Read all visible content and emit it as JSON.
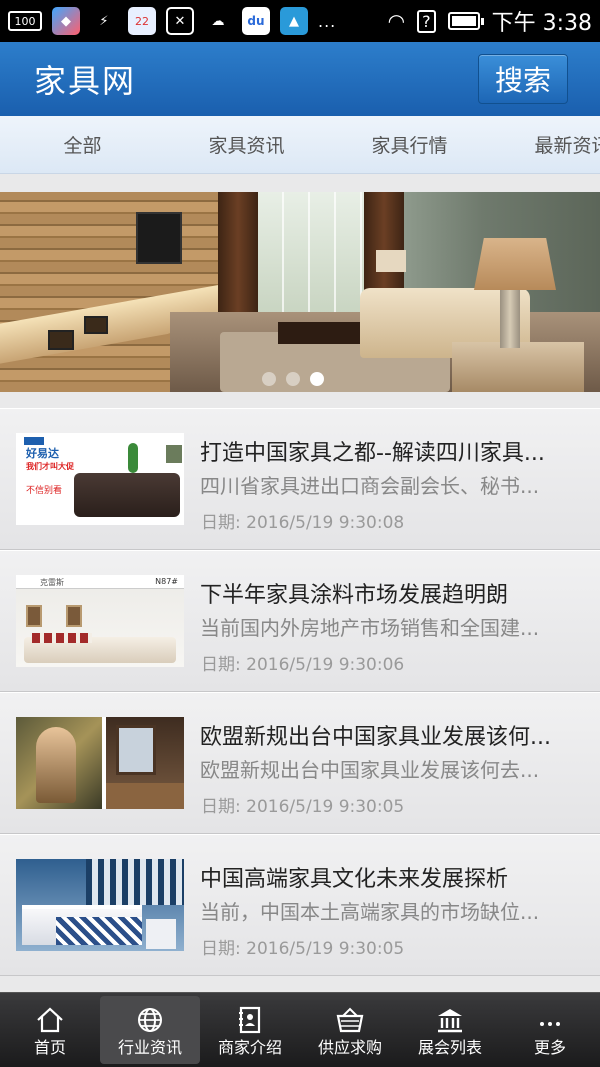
{
  "status_bar": {
    "left_icons": [
      "battery-100-icon",
      "app-store-icon",
      "usb-icon",
      "calendar-icon",
      "close-box-icon",
      "weather-icon",
      "baidu-icon",
      "kaiqi-icon",
      "more-dots-icon"
    ],
    "battery_badge": "100",
    "calendar_day": "22",
    "more": "...",
    "time": "下午 3:38"
  },
  "header": {
    "title": "家具网",
    "search_label": "搜索",
    "accent": "#1f6bb9"
  },
  "tabs": [
    {
      "label": "全部"
    },
    {
      "label": "家具资讯"
    },
    {
      "label": "家具行情"
    },
    {
      "label": "最新资讯"
    }
  ],
  "banner": {
    "slides": 3,
    "active_slide": 3
  },
  "news": [
    {
      "title": "打造中国家具之都--解读四川家具...",
      "summary": "四川省家具进出口商会副会长、秘书...",
      "date": "日期: 2016/5/19 9:30:08",
      "thumb": {
        "brand": "好易达",
        "line1": "我们才叫大促",
        "line2": "不信别看"
      }
    },
    {
      "title": "下半年家具涂料市场发展趋明朗",
      "summary": "当前国内外房地产市场销售和全国建...",
      "date": "日期: 2016/5/19 9:30:06",
      "thumb": {
        "brand": "克雷斯",
        "code": "N87#"
      }
    },
    {
      "title": "欧盟新规出台中国家具业发展该何...",
      "summary": "欧盟新规出台中国家具业发展该何去...",
      "date": "日期: 2016/5/19 9:30:05",
      "thumb": {}
    },
    {
      "title": "中国高端家具文化未来发展探析",
      "summary": "当前，中国本土高端家具的市场缺位...",
      "date": "日期: 2016/5/19 9:30:05",
      "thumb": {}
    }
  ],
  "bottom_nav": [
    {
      "label": "首页",
      "icon": "home-icon"
    },
    {
      "label": "行业资讯",
      "icon": "globe-icon",
      "active": true
    },
    {
      "label": "商家介绍",
      "icon": "contact-book-icon"
    },
    {
      "label": "供应求购",
      "icon": "basket-icon"
    },
    {
      "label": "展会列表",
      "icon": "bank-icon"
    },
    {
      "label": "更多",
      "icon": "more-dots-icon"
    }
  ]
}
